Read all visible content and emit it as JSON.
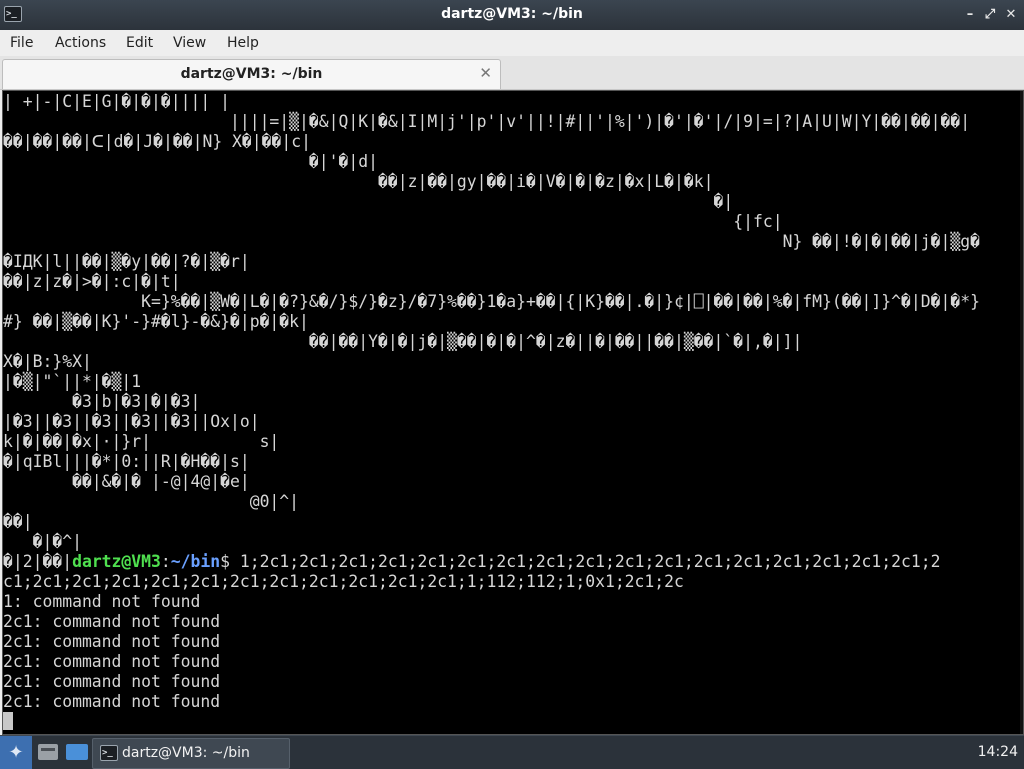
{
  "window": {
    "title": "dartz@VM3: ~/bin",
    "app_icon": "terminal-icon",
    "controls": {
      "minimize": "–",
      "maximize": "⤢",
      "close": "✕"
    }
  },
  "menu": {
    "file": "File",
    "actions": "Actions",
    "edit": "Edit",
    "view": "View",
    "help": "Help"
  },
  "tab": {
    "label": "dartz@VM3: ~/bin",
    "close": "✕"
  },
  "terminal": {
    "garbage_lines": [
      "| +|-|C|E|G|�|�|�|||| |",
      "                       ||||=|▒|�&|Q|K|�&|I|M|j'|p'|v'||!|#||'|%|')|�'|�'|/|9|=|?|A|U|W|Y|��|��|��|",
      "��|��|��|ᑕ|d�|J�|��|N} X�|��|c|",
      "                               �|'�|d|",
      "                                      ��|z|��|gy|��|i�|V�|�|�z|�x|L�|�k|",
      "                                                                        �|",
      "                                                                          {|fc|",
      "                                                                               N} ��|!�|�|��|j�|▒g�",
      "�IДK|l||��|▒�y|��|?�|▒�r|",
      "��|z|z�|>�|:c|�|t|",
      "              K=}%��|▒W�|L�|�?}&�/}$/}�z}/�7}%��}1�a}+��|{|K}��|.�|}¢|⎕|��|��|%�|fM}(��|]}^�|D�|�*}",
      "#} ��|▒��|K}'-}#�l}-�&}�|p�|�k|",
      "                               ��|��|Y�|�|j�|▒��|�|�|^�|z�||�|��||��|▒��|`�|,�|]|",
      "X�|B:}%X|",
      "|�▒|\"`||*|�▒|1",
      "       �3|b|�3|�|�3|",
      "|�3||�3||�3||�3||�3||Ox|o|",
      "k|�|��|�x|·|}r|           s|",
      "�|qIBl|||�*|0:||R|�H��|s|",
      "       ��|&�|� |-@|4@|�e|",
      "                         @0|^|",
      "��|",
      "   �|�^|"
    ],
    "prompt_prefix": "�|2|��|",
    "prompt_user": "dartz@VM3",
    "prompt_sep": ":",
    "prompt_path": "~/bin",
    "prompt_dollar": "$ ",
    "command_part1": "1;2c1;2c1;2c1;2c1;2c1;2c1;2c1;2c1;2c1;2c1;2c1;2c1;2c1;2c1;2c1;2c1;2c1;2",
    "command_part2": "c1;2c1;2c1;2c1;2c1;2c1;2c1;2c1;2c1;2c1;2c1;2c1;1;112;112;1;0x1;2c1;2c",
    "output_lines": [
      "1: command not found",
      "2c1: command not found",
      "2c1: command not found",
      "2c1: command not found",
      "2c1: command not found",
      "2c1: command not found"
    ]
  },
  "taskbar": {
    "start_icon": "start-menu-icon",
    "files_icon": "file-manager-icon",
    "desktop_icon": "show-desktop-icon",
    "task_label": "dartz@VM3: ~/bin",
    "clock": "14:24"
  }
}
